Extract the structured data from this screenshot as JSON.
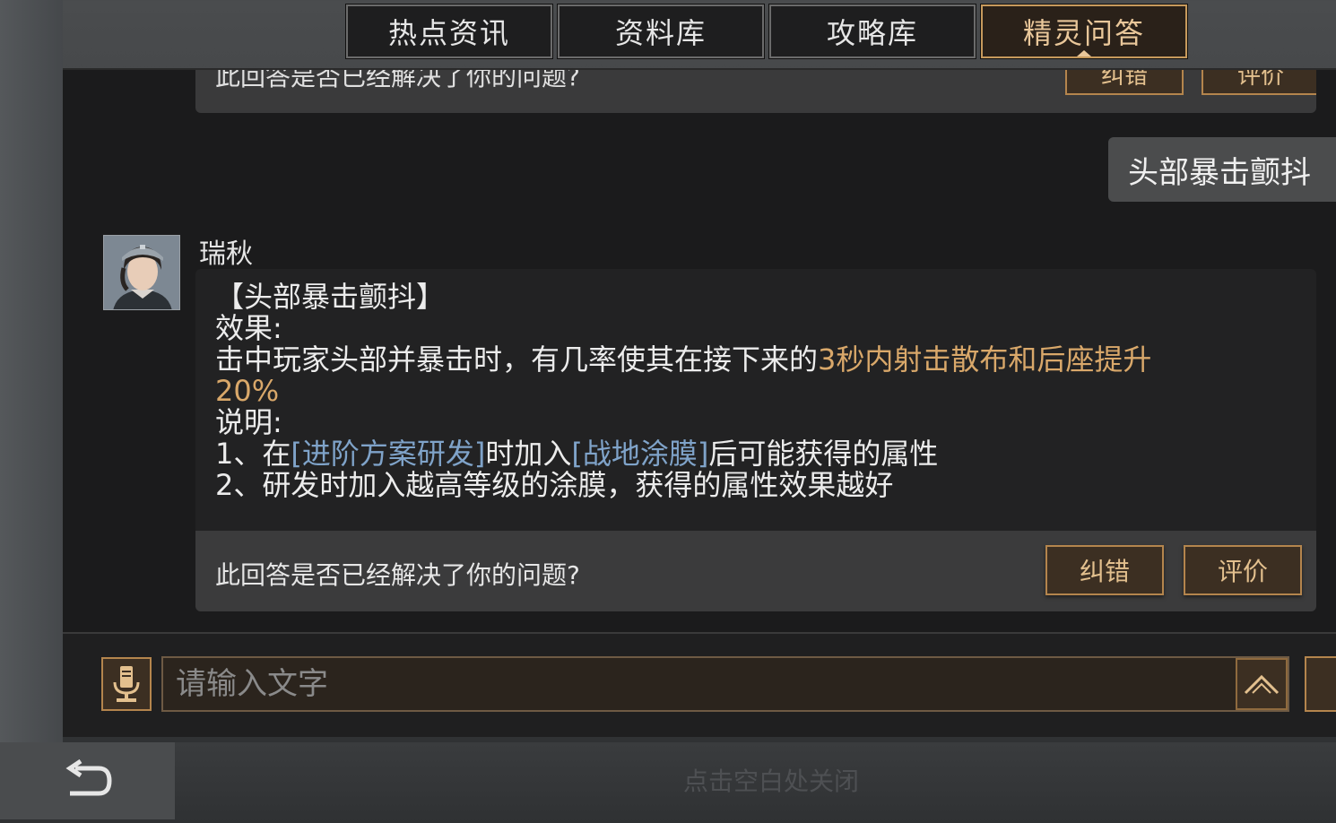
{
  "tabs": [
    {
      "label": "热点资讯",
      "active": false
    },
    {
      "label": "资料库",
      "active": false
    },
    {
      "label": "攻略库",
      "active": false
    },
    {
      "label": "精灵问答",
      "active": true
    }
  ],
  "previous_answer": {
    "question_text": "此回答是否已经解决了你的问题?",
    "correct_label": "纠错",
    "rate_label": "评价"
  },
  "user_message": "头部暴击颤抖",
  "bot": {
    "name": "瑞秋",
    "avatar_icon": "character-portrait"
  },
  "answer": {
    "title": "【头部暴击颤抖】",
    "effect_label": "效果:",
    "effect_text_prefix": "击中玩家头部并暴击时，有几率使其在接下来的",
    "effect_text_highlight_1": "3秒内射击散布和后座提升",
    "effect_text_highlight_2": "20%",
    "note_label": "说明:",
    "note_1_prefix": "1、在",
    "note_1_link_1": "[进阶方案研发]",
    "note_1_middle": "时加入",
    "note_1_link_2": "[战地涂膜]",
    "note_1_suffix": "后可能获得的属性",
    "note_2": "2、研发时加入越高等级的涂膜，获得的属性效果越好"
  },
  "feedback": {
    "question_text": "此回答是否已经解决了你的问题?",
    "correct_label": "纠错",
    "rate_label": "评价"
  },
  "input": {
    "placeholder": "请输入文字"
  },
  "footer": {
    "close_hint": "点击空白处关闭"
  },
  "colors": {
    "accent_gold": "#d9a86a",
    "link_blue": "#7fa3c9",
    "button_border": "#b4854d"
  }
}
